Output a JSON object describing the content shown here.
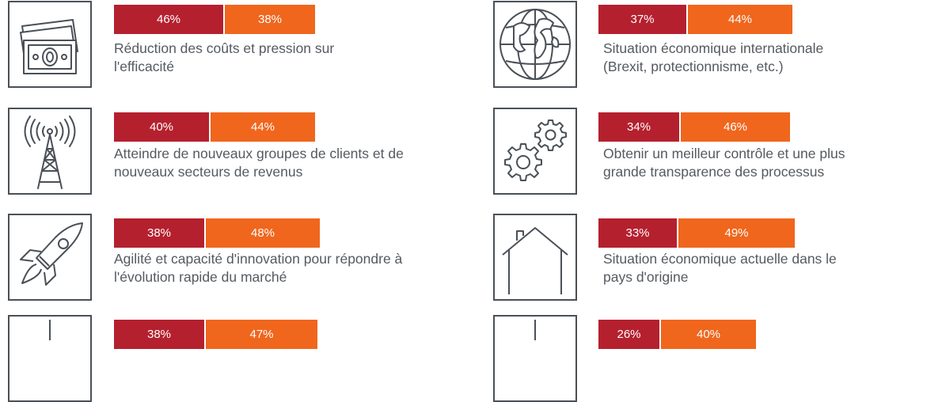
{
  "chart_data": {
    "type": "bar",
    "stacked": true,
    "items": [
      {
        "id": "costs",
        "icon": "money-icon",
        "values": [
          46,
          38
        ],
        "labels": [
          "46%",
          "38%"
        ],
        "text": [
          "Réduction des coûts et pression sur",
          "l'efficacité"
        ]
      },
      {
        "id": "intl",
        "icon": "globe-icon",
        "values": [
          37,
          44
        ],
        "labels": [
          "37%",
          "44%"
        ],
        "text": [
          "Situation économique internationale",
          "(Brexit, protectionnisme, etc.)"
        ]
      },
      {
        "id": "clients",
        "icon": "antenna-icon",
        "values": [
          40,
          44
        ],
        "labels": [
          "40%",
          "44%"
        ],
        "text": [
          "Atteindre de nouveaux groupes de clients et de",
          "nouveaux secteurs de revenus"
        ]
      },
      {
        "id": "control",
        "icon": "gears-icon",
        "values": [
          34,
          46
        ],
        "labels": [
          "34%",
          "46%"
        ],
        "text": [
          "Obtenir un meilleur contrôle et une plus",
          "grande transparence des processus"
        ]
      },
      {
        "id": "agility",
        "icon": "rocket-icon",
        "values": [
          38,
          48
        ],
        "labels": [
          "38%",
          "48%"
        ],
        "text": [
          "Agilité et capacité d'innovation pour répondre à",
          "l'évolution rapide du marché"
        ]
      },
      {
        "id": "home",
        "icon": "house-icon",
        "values": [
          33,
          49
        ],
        "labels": [
          "33%",
          "49%"
        ],
        "text": [
          "Situation économique actuelle dans le",
          "pays d'origine"
        ]
      },
      {
        "id": "row4a",
        "icon": "partial-icon",
        "values": [
          38,
          47
        ],
        "labels": [
          "38%",
          "47%"
        ],
        "text": [
          "",
          ""
        ]
      },
      {
        "id": "row4b",
        "icon": "partial-icon",
        "values": [
          26,
          40
        ],
        "labels": [
          "26%",
          "40%"
        ],
        "text": [
          "",
          ""
        ]
      }
    ],
    "colors": {
      "dark": "#b5202e",
      "light": "#f0661d"
    }
  }
}
